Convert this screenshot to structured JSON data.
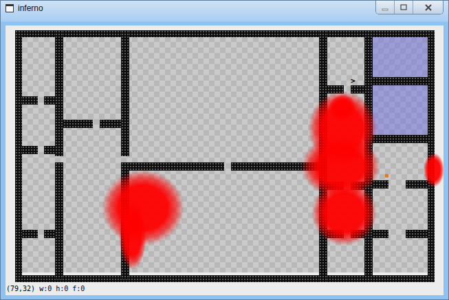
{
  "window": {
    "title": "inferno"
  },
  "map": {
    "stairs": ">"
  },
  "status_bar": {
    "text": "(79,32) w:0 h:0 f:0"
  }
}
